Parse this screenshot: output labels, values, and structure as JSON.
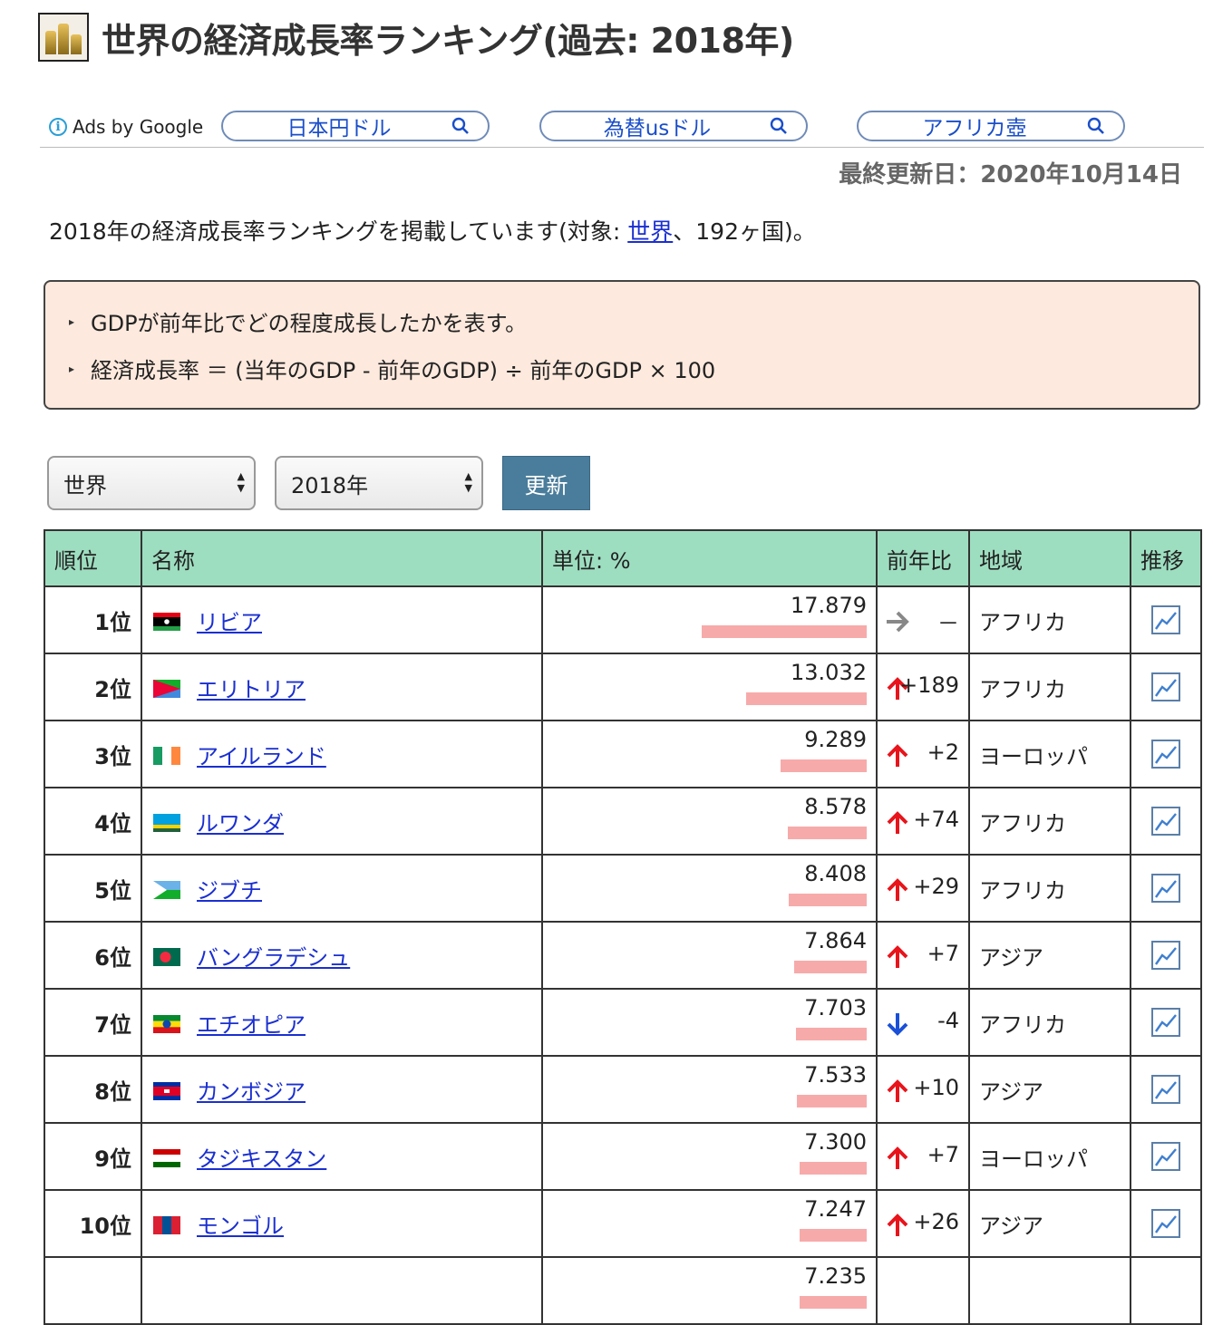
{
  "header": {
    "title": "世界の経済成長率ランキング(過去: 2018年)"
  },
  "ads": {
    "label": "Ads by Google",
    "links": [
      "日本円ドル",
      "為替usドル",
      "アフリカ壺"
    ]
  },
  "updated": "最終更新日：2020年10月14日",
  "intro": {
    "before": "2018年の経済成長率ランキングを掲載しています(対象: ",
    "link": "世界",
    "after": "、192ヶ国)。"
  },
  "info": {
    "line1": "GDPが前年比でどの程度成長したかを表す。",
    "line2": "経済成長率 ＝ (当年のGDP - 前年のGDP) ÷ 前年のGDP × 100"
  },
  "controls": {
    "region": "世界",
    "year": "2018年",
    "update": "更新"
  },
  "table": {
    "headers": [
      "順位",
      "名称",
      "単位: %",
      "前年比",
      "地域",
      "推移"
    ],
    "rows": [
      {
        "rank": "1位",
        "name": "リビア",
        "value": "17.879",
        "bar": 17.879,
        "dir": "flat",
        "change": "－",
        "region": "アフリカ"
      },
      {
        "rank": "2位",
        "name": "エリトリア",
        "value": "13.032",
        "bar": 13.032,
        "dir": "up",
        "change": "+189",
        "region": "アフリカ"
      },
      {
        "rank": "3位",
        "name": "アイルランド",
        "value": "9.289",
        "bar": 9.289,
        "dir": "up",
        "change": "+2",
        "region": "ヨーロッパ"
      },
      {
        "rank": "4位",
        "name": "ルワンダ",
        "value": "8.578",
        "bar": 8.578,
        "dir": "up",
        "change": "+74",
        "region": "アフリカ"
      },
      {
        "rank": "5位",
        "name": "ジブチ",
        "value": "8.408",
        "bar": 8.408,
        "dir": "up",
        "change": "+29",
        "region": "アフリカ"
      },
      {
        "rank": "6位",
        "name": "バングラデシュ",
        "value": "7.864",
        "bar": 7.864,
        "dir": "up",
        "change": "+7",
        "region": "アジア"
      },
      {
        "rank": "7位",
        "name": "エチオピア",
        "value": "7.703",
        "bar": 7.703,
        "dir": "down",
        "change": "-4",
        "region": "アフリカ"
      },
      {
        "rank": "8位",
        "name": "カンボジア",
        "value": "7.533",
        "bar": 7.533,
        "dir": "up",
        "change": "+10",
        "region": "アジア"
      },
      {
        "rank": "9位",
        "name": "タジキスタン",
        "value": "7.300",
        "bar": 7.3,
        "dir": "up",
        "change": "+7",
        "region": "ヨーロッパ"
      },
      {
        "rank": "10位",
        "name": "モンゴル",
        "value": "7.247",
        "bar": 7.247,
        "dir": "up",
        "change": "+26",
        "region": "アジア"
      },
      {
        "rank": "",
        "name": "",
        "value": "7.235",
        "bar": 7.235,
        "dir": "",
        "change": "",
        "region": ""
      }
    ]
  },
  "colors": {
    "header_bg": "#9edec0",
    "bar": "#f7aaaa",
    "up": "#e8141b",
    "down": "#1a50d8",
    "flat": "#888888",
    "link": "#1a2fd0"
  }
}
